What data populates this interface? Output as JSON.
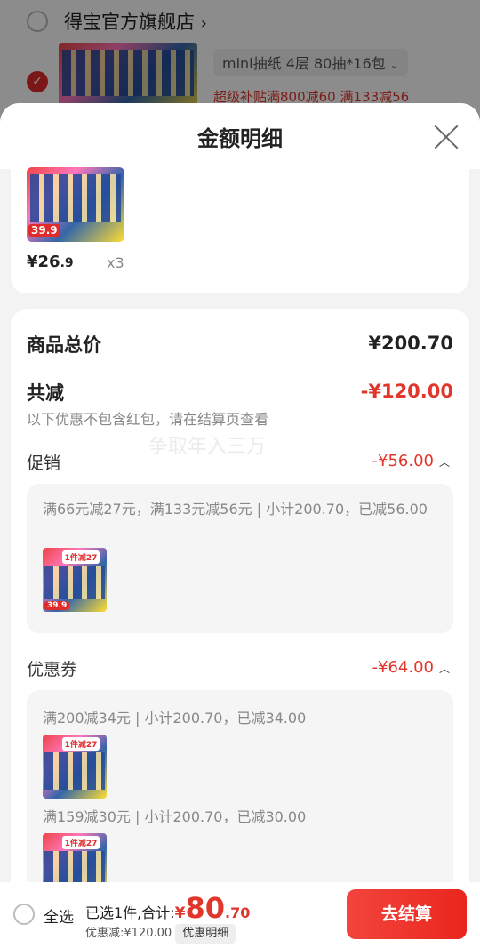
{
  "background": {
    "store_name": "得宝官方旗舰店",
    "store_chevron": "›",
    "variant": "mini抽纸 4层 80抽*16包",
    "variant_chevron": "⌄",
    "promo": "超级补贴满800减60  满133减56",
    "check_mark": "✓"
  },
  "sheet": {
    "title": "金额明细",
    "close_icon": "close-icon"
  },
  "top_item": {
    "price_symbol": "¥",
    "price_int": "26",
    "price_dec": ".9",
    "qty": "x3",
    "thumb_price": "39.9",
    "thumb_text": "四层加厚 潮流品味"
  },
  "summary": {
    "total_label": "商品总价",
    "total_value": "¥200.70",
    "reduce_label": "共减",
    "reduce_value": "-¥120.00",
    "reduce_note": "以下优惠不包含红包，请在结算页查看",
    "watermark": "争取年入三万"
  },
  "promotion": {
    "label": "促销",
    "value": "-¥56.00",
    "caret": "︿",
    "rule": "满66元减27元，满133元减56元 | 小计200.70，已减56.00",
    "thumb_badge": "1件减27",
    "thumb_price": "39.9"
  },
  "coupon": {
    "label": "优惠券",
    "value": "-¥64.00",
    "caret": "︿",
    "items": [
      {
        "rule": "满200减34元 | 小计200.70，已减34.00",
        "thumb_badge": "1件减27"
      },
      {
        "rule": "满159减30元 | 小计200.70，已减30.00",
        "thumb_badge": "1件减27"
      }
    ]
  },
  "bottom_bar": {
    "select_all": "全选",
    "selected_text": "已选1件,合计:",
    "currency": "¥",
    "total_int": "80",
    "total_dec": ".70",
    "discount_text": "优惠减:¥120.00",
    "detail_button": "优惠明细",
    "checkout_button": "去结算"
  },
  "colors": {
    "accent_red": "#e0362c",
    "checkout_red": "#f2453d"
  }
}
